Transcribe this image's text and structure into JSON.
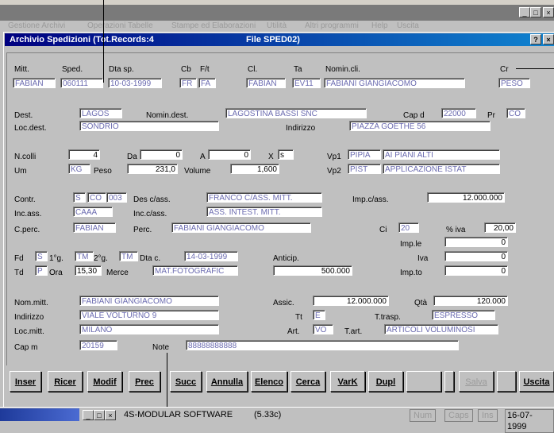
{
  "window": {
    "title": "Archivio Spedizioni (Tot.Records:4",
    "file": "File SPED02)"
  },
  "menu": [
    "Gestione Archivi",
    "Operazioni Tabelle",
    "Stampe ed Elaborazioni",
    "Utilità",
    "Altri programmi",
    "Help",
    "Uscita"
  ],
  "fields": {
    "mitt_label": "Mitt.",
    "mitt": "FABIAN",
    "sped_label": "Sped.",
    "sped": "060111",
    "dtasp_label": "Dta sp.",
    "dtasp": "10-03-1999",
    "cb_label": "Cb",
    "cb": "FR",
    "ft_label": "F/t",
    "ft": "FA",
    "cl_label": "Cl.",
    "cl": "FABIAN",
    "ta_label": "Ta",
    "ta": "EV11",
    "nomincli_label": "Nomin.cli.",
    "nomincli": "FABIANI GIANGIACOMO",
    "cr_label": "Cr",
    "cr": "PESO",
    "dest_label": "Dest.",
    "dest": "LAGOS",
    "nomindest_label": "Nomin.dest.",
    "nomindest": "LAGOSTINA BASSI SNC",
    "capd_label": "Cap d",
    "capd": "22000",
    "pr_label": "Pr",
    "pr": "CO",
    "locdest_label": "Loc.dest.",
    "locdest": "SONDRIO",
    "indirizzo_label": "Indirizzo",
    "indirizzo": "PIAZZA GOETHE 56",
    "ncolli_label": "N.colli",
    "ncolli": "4",
    "da_label": "Da",
    "da": "0",
    "a_label": "A",
    "a": "0",
    "x_label": "X",
    "x": "s",
    "vp1_label": "Vp1",
    "vp1_code": "PIPIA",
    "vp1": "AI PIANI ALTI",
    "um_label": "Um",
    "um": "KG",
    "peso_label": "Peso",
    "peso": "231,0",
    "volume_label": "Volume",
    "volume": "1,600",
    "vp2_label": "Vp2",
    "vp2_code": "PIST",
    "vp2": "APPLICAZIONE ISTAT",
    "contr_label": "Contr.",
    "contr_a": "S",
    "contr_b": "CO",
    "contr_c": "003",
    "desass_label": "Des c/ass.",
    "desass": "FRANCO C/ASS. MITT.",
    "impass_label": "Imp.c/ass.",
    "impass": "12.000.000",
    "incass_label": "Inc.ass.",
    "incass": "CAAA",
    "incass2_label": "Inc.c/ass.",
    "incass2": "ASS. INTEST. MITT.",
    "cperc_label": "C.perc.",
    "cperc": "FABIAN",
    "perc_label": "Perc.",
    "perc": "FABIANI GIANGIACOMO",
    "ci_label": "Ci",
    "ci": "20",
    "iva_pct_label": "% iva",
    "iva_pct": "20,00",
    "imple_label": "Imp.le",
    "imple": "0",
    "iva_label": "Iva",
    "iva": "0",
    "impto_label": "Imp.to",
    "impto": "0",
    "fd_label": "Fd",
    "fd": "S",
    "fd1g_label": "1°g.",
    "fd1g": "TM",
    "fd2g_label": "2°g.",
    "fd2g": "TM",
    "dtac_label": "Dta c.",
    "dtac": "14-03-1999",
    "td_label": "Td",
    "td": "P",
    "ora_label": "Ora",
    "ora": "15,30",
    "merce_label": "Merce",
    "merce": "MAT.FOTOGRAFIC",
    "anticip_label": "Anticip.",
    "anticip": "500.000",
    "nommitt_label": "Nom.mitt.",
    "nommitt": "FABIANI GIANGIACOMO",
    "assic_label": "Assic.",
    "assic": "12.000.000",
    "qta_label": "Qtà",
    "qta": "120.000",
    "indirizzo2_label": "Indirizzo",
    "indirizzo2": "VIALE VOLTURNO 9",
    "tt_label": "Tt",
    "tt": "E",
    "ttrasp_label": "T.trasp.",
    "ttrasp": "ESPRESSO",
    "locmitt_label": "Loc.mitt.",
    "locmitt": "MILANO",
    "art_label": "Art.",
    "art": "VO",
    "tart_label": "T.art.",
    "tart": "ARTICOLI VOLUMINOSI",
    "capm_label": "Cap m",
    "capm": "20159",
    "note_label": "Note",
    "note": "88888888888"
  },
  "buttons": [
    "Inser",
    "Ricer",
    "Modif",
    "Prec",
    "Succ",
    "Annulla",
    "Elenco",
    "Cerca",
    "VarK",
    "Dupl",
    "",
    "",
    "Salva",
    "",
    "Uscita"
  ],
  "statusbar": {
    "company": "4S-MODULAR SOFTWARE",
    "version": "(5.33c)",
    "num": "Num",
    "caps": "Caps",
    "ins": "Ins",
    "date": "16-07-1999"
  }
}
